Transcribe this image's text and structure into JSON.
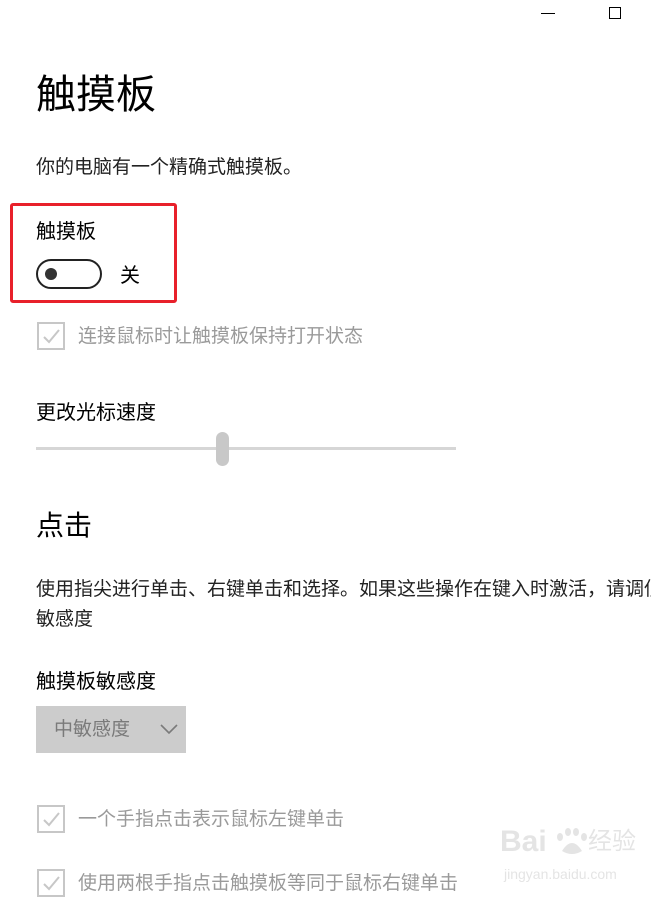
{
  "page": {
    "title": "触摸板",
    "description": "你的电脑有一个精确式触摸板。"
  },
  "touchpad_toggle": {
    "label": "触摸板",
    "state_label": "关",
    "on": false
  },
  "keep_on_with_mouse": {
    "label": "连接鼠标时让触摸板保持打开状态",
    "checked": true
  },
  "cursor_speed": {
    "label": "更改光标速度",
    "value_fraction": 0.44
  },
  "taps": {
    "heading": "点击",
    "description": "使用指尖进行单击、右键单击和选择。如果这些操作在键入时激活，请调低敏感度",
    "sensitivity_label": "触摸板敏感度",
    "sensitivity_value": "中敏感度",
    "single_tap_label": "一个手指点击表示鼠标左键单击",
    "two_finger_tap_label": "使用两根手指点击触摸板等同于鼠标右键单击"
  },
  "watermark": {
    "text": "Bai 经验",
    "url": "jingyan.baidu.com"
  },
  "colors": {
    "highlight": "#e8202a",
    "disabled_text": "#9a9a9a",
    "dropdown_bg": "#cccccc"
  }
}
